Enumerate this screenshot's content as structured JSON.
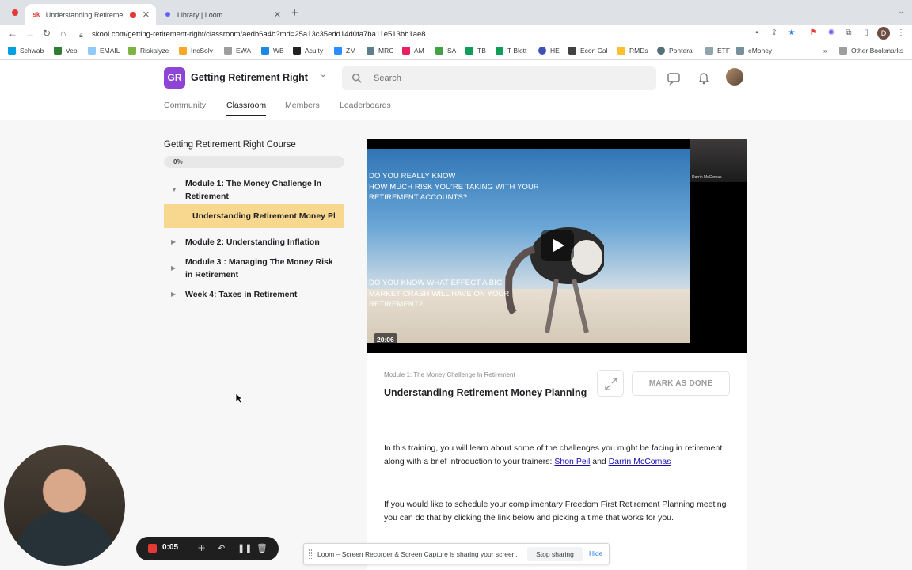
{
  "browser": {
    "tabs": [
      {
        "title": "Understanding Retirement",
        "favicon": "sk",
        "active": true,
        "recording": true
      },
      {
        "title": "Library | Loom",
        "favicon": "loom",
        "active": false
      }
    ],
    "url": "skool.com/getting-retirement-right/classroom/aedb6a4b?md=25a13c35edd14d0fa7ba11e513bb1ae8",
    "profile_initial": "D",
    "bookmarks": [
      "Schwab",
      "Veo",
      "EMAIL",
      "Riskalyze",
      "IncSolv",
      "EWA",
      "WB",
      "Acuity",
      "ZM",
      "MRC",
      "AM",
      "SA",
      "TB",
      "T Blott",
      "HE",
      "Econ Cal",
      "RMDs",
      "Pontera",
      "ETF",
      "eMoney"
    ],
    "other_bookmarks": "Other Bookmarks",
    "overflow": "»"
  },
  "header": {
    "group_initials": "GR",
    "group_name": "Getting Retirement Right",
    "search_placeholder": "Search",
    "nav": [
      "Community",
      "Classroom",
      "Members",
      "Leaderboards"
    ],
    "active_nav": "Classroom"
  },
  "course": {
    "title": "Getting Retirement Right Course",
    "progress": "0%",
    "modules": [
      {
        "label": "Module 1: The Money Challenge In Retirement",
        "expanded": true
      },
      {
        "label": "Module 2: Understanding Inflation"
      },
      {
        "label": "Module 3 : Managing The Money Risk in Retirement"
      },
      {
        "label": "Week 4: Taxes in Retirement"
      }
    ],
    "active_lesson": "Understanding Retirement Money Planning"
  },
  "video": {
    "text_top": "DO YOU REALLY KNOW\nHOW MUCH RISK YOU'RE TAKING WITH YOUR\nRETIREMENT ACCOUNTS?",
    "text_bottom": "DO YOU KNOW WHAT EFFECT A BIG\nMARKET CRASH WILL HAVE ON YOUR\nRETIREMENT?",
    "duration": "20:06",
    "pip_caption": "Darrin McComas"
  },
  "lesson": {
    "breadcrumb": "Module 1: The Money Challenge In Retirement",
    "title": "Understanding Retirement Money Planning",
    "mark_done": "MARK AS DONE",
    "para1_text": "In this training, you will learn about some of the challenges you might be facing in retirement along with a brief introduction to your trainers: ",
    "trainer1": "Shon Peil",
    "and": " and ",
    "trainer2": "Darrin McComas",
    "para2": "If you would like to schedule your complimentary Freedom First Retirement Planning meeting you can do that by clicking the link below and picking a time that works for you."
  },
  "loom": {
    "timer": "0:05",
    "share_message": "Loom – Screen Recorder & Screen Capture is sharing your screen.",
    "stop_label": "Stop sharing",
    "hide_label": "Hide"
  },
  "colors": {
    "accent": "#8e44d6",
    "active_lesson_bg": "#f8d88f",
    "record_red": "#e53935"
  }
}
